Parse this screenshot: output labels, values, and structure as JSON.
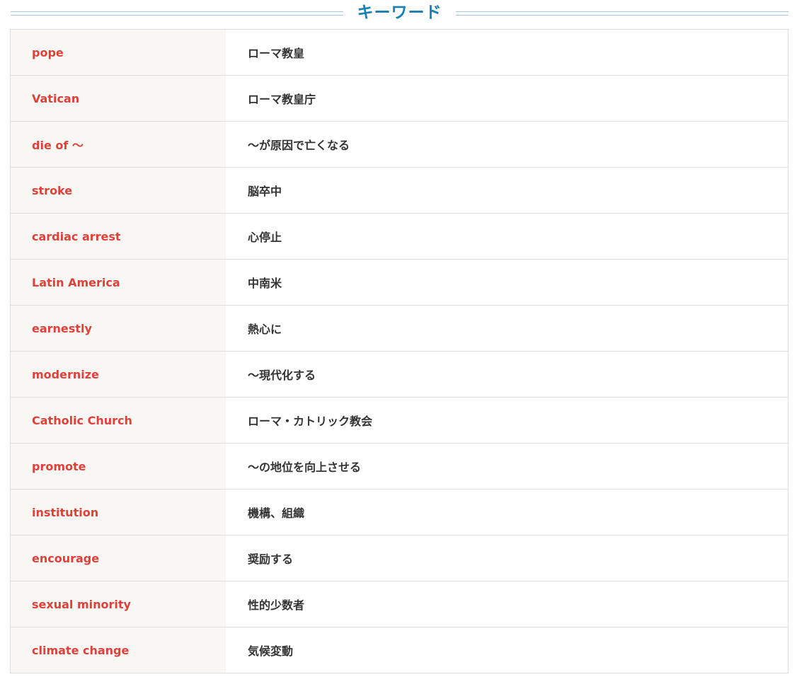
{
  "heading": {
    "title": "キーワード"
  },
  "colors": {
    "heading": "#1a7fb4",
    "term": "#e0403a",
    "meaning": "#333333",
    "term_bg": "#f8f7f4",
    "border": "#dddddd"
  },
  "keywords": [
    {
      "term": "pope",
      "meaning": "ローマ教皇"
    },
    {
      "term": "Vatican",
      "meaning": "ローマ教皇庁"
    },
    {
      "term": "die of 〜",
      "meaning": "〜が原因で亡くなる"
    },
    {
      "term": "stroke",
      "meaning": "脳卒中"
    },
    {
      "term": "cardiac arrest",
      "meaning": "心停止"
    },
    {
      "term": "Latin America",
      "meaning": "中南米"
    },
    {
      "term": "earnestly",
      "meaning": "熱心に"
    },
    {
      "term": "modernize",
      "meaning": "〜現代化する"
    },
    {
      "term": "Catholic Church",
      "meaning": "ローマ・カトリック教会"
    },
    {
      "term": "promote",
      "meaning": "〜の地位を向上させる"
    },
    {
      "term": "institution",
      "meaning": "機構、組織"
    },
    {
      "term": "encourage",
      "meaning": "奨励する"
    },
    {
      "term": "sexual minority",
      "meaning": "性的少数者"
    },
    {
      "term": "climate change",
      "meaning": "気候変動"
    }
  ]
}
